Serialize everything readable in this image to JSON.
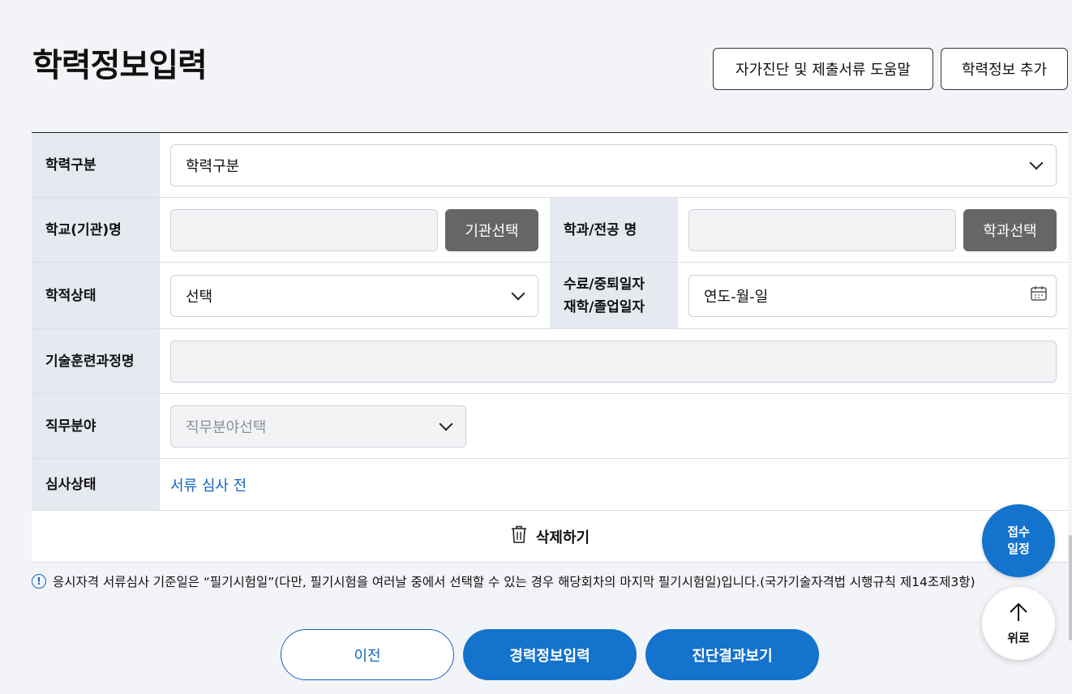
{
  "header": {
    "title": "학력정보입력",
    "help_button": "자가진단 및 제출서류 도움말",
    "add_button": "학력정보 추가"
  },
  "form": {
    "education_type": {
      "label": "학력구분",
      "value": "학력구분"
    },
    "school": {
      "label": "학교(기관)명",
      "value": "",
      "button": "기관선택"
    },
    "major": {
      "label": "학과/전공 명",
      "value": "",
      "button": "학과선택"
    },
    "academic_status": {
      "label": "학적상태",
      "value": "선택"
    },
    "date": {
      "label_line1": "수료/중퇴일자",
      "label_line2": "재학/졸업일자",
      "placeholder": "연도-월-일"
    },
    "training_course": {
      "label": "기술훈련과정명",
      "value": ""
    },
    "job_field": {
      "label": "직무분야",
      "value": "직무분야선택"
    },
    "review_status": {
      "label": "심사상태",
      "value": "서류 심사 전"
    },
    "delete_label": "삭제하기"
  },
  "notice": {
    "icon": "exclamation-circle-icon",
    "text": "응시자격 서류심사 기준일은 “필기시험일”(다만, 필기시험을 여러날 중에서 선택할 수 있는 경우 해당회차의 마지막 필기시험일)입니다.(국가기술자격법 시행규칙 제14조제3항)"
  },
  "buttons": {
    "prev": "이전",
    "career": "경력정보입력",
    "result": "진단결과보기"
  },
  "floating": {
    "schedule_line1": "접수",
    "schedule_line2": "일정",
    "top": "위로"
  },
  "colors": {
    "primary": "#1473cc",
    "link": "#1565c0",
    "label_bg": "#e5e9f0",
    "gray_button": "#666666"
  }
}
